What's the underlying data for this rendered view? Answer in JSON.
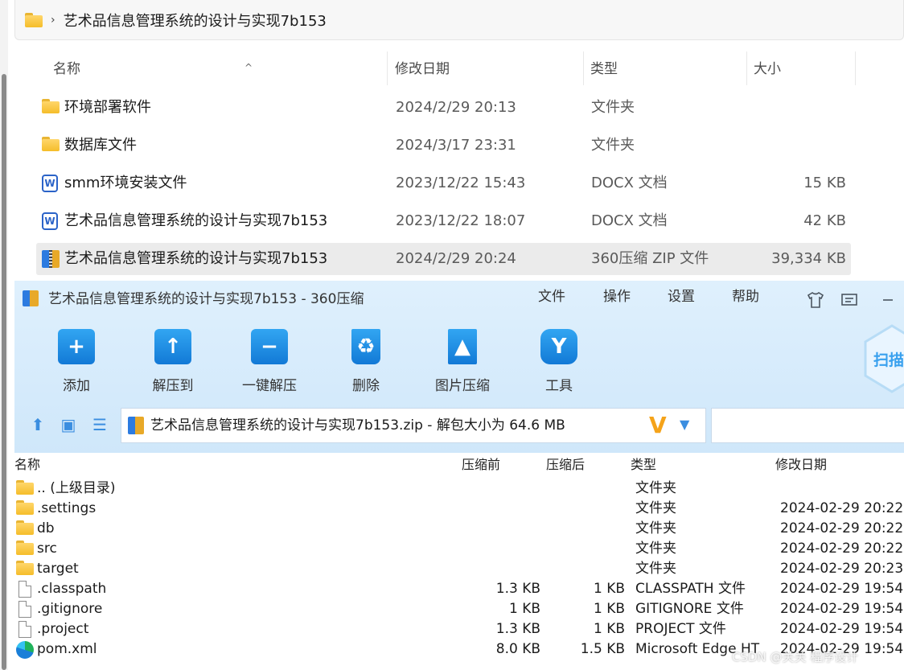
{
  "explorer": {
    "breadcrumb": "艺术品信息管理系统的设计与实现7b153",
    "breadcrumb_separator": "›",
    "columns": {
      "name": "名称",
      "modified": "修改日期",
      "type": "类型",
      "size": "大小"
    },
    "rows": [
      {
        "icon": "folder-icon",
        "name": "环境部署软件",
        "modified": "2024/2/29 20:13",
        "type": "文件夹",
        "size": ""
      },
      {
        "icon": "folder-icon",
        "name": "数据库文件",
        "modified": "2024/3/17 23:31",
        "type": "文件夹",
        "size": ""
      },
      {
        "icon": "docx-icon",
        "name": "smm环境安装文件",
        "modified": "2023/12/22 15:43",
        "type": "DOCX 文档",
        "size": "15 KB"
      },
      {
        "icon": "docx-icon",
        "name": "艺术品信息管理系统的设计与实现7b153",
        "modified": "2023/12/22 18:07",
        "type": "DOCX 文档",
        "size": "42 KB"
      },
      {
        "icon": "zip-icon",
        "name": "艺术品信息管理系统的设计与实现7b153",
        "modified": "2024/2/29 20:24",
        "type": "360压缩 ZIP 文件",
        "size": "39,334 KB",
        "selected": true
      }
    ]
  },
  "zip": {
    "title": "艺术品信息管理系统的设计与实现7b153 - 360压缩",
    "menu": {
      "file": "文件",
      "operate": "操作",
      "settings": "设置",
      "help": "帮助"
    },
    "toolbar": {
      "add": "添加",
      "extract_to": "解压到",
      "one_click_extract": "一键解压",
      "delete": "删除",
      "image_compress": "图片压缩",
      "tools": "工具"
    },
    "scan_label": "扫描",
    "path_text": "艺术品信息管理系统的设计与实现7b153.zip - 解包大小为 64.6 MB",
    "list_columns": {
      "name": "名称",
      "compressed": "压缩前",
      "packed": "压缩后",
      "type": "类型",
      "modified": "修改日期"
    },
    "rows": [
      {
        "icon": "folder-icon",
        "name": ".. (上级目录)",
        "compressed": "",
        "packed": "",
        "type": "文件夹",
        "modified": ""
      },
      {
        "icon": "folder-icon",
        "name": ".settings",
        "compressed": "",
        "packed": "",
        "type": "文件夹",
        "modified": "2024-02-29 20:22"
      },
      {
        "icon": "folder-icon",
        "name": "db",
        "compressed": "",
        "packed": "",
        "type": "文件夹",
        "modified": "2024-02-29 20:22"
      },
      {
        "icon": "folder-icon",
        "name": "src",
        "compressed": "",
        "packed": "",
        "type": "文件夹",
        "modified": "2024-02-29 20:22"
      },
      {
        "icon": "folder-icon",
        "name": "target",
        "compressed": "",
        "packed": "",
        "type": "文件夹",
        "modified": "2024-02-29 20:23"
      },
      {
        "icon": "file-icon",
        "name": ".classpath",
        "compressed": "1.3 KB",
        "packed": "1 KB",
        "type": "CLASSPATH 文件",
        "modified": "2024-02-29 19:54"
      },
      {
        "icon": "file-icon",
        "name": ".gitignore",
        "compressed": "1 KB",
        "packed": "1 KB",
        "type": "GITIGNORE 文件",
        "modified": "2024-02-29 19:54"
      },
      {
        "icon": "file-icon",
        "name": ".project",
        "compressed": "1.3 KB",
        "packed": "1 KB",
        "type": "PROJECT 文件",
        "modified": "2024-02-29 19:54"
      },
      {
        "icon": "edge-icon",
        "name": "pom.xml",
        "compressed": "8.0 KB",
        "packed": "1.5 KB",
        "type": "Microsoft Edge HT",
        "modified": "2024-02-29 19:54"
      }
    ]
  },
  "watermark": "CSDN @关关 程序设计"
}
